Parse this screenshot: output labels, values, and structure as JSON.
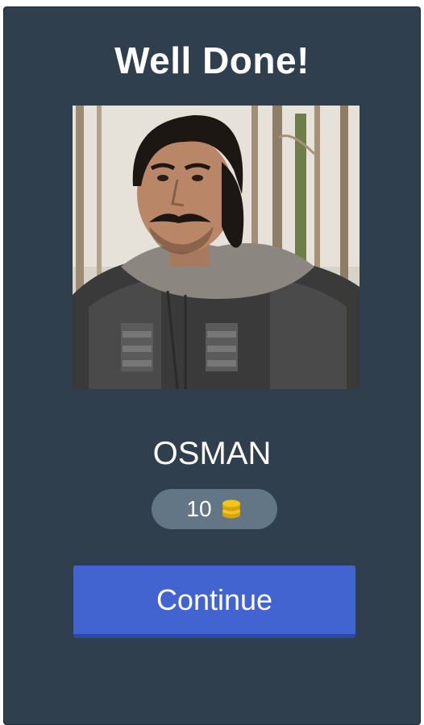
{
  "header": {
    "title": "Well Done!"
  },
  "image": {
    "icon": "character-portrait"
  },
  "answer": {
    "text": "OSMAN"
  },
  "reward": {
    "amount": "10",
    "icon": "coin-stack-icon",
    "coin_color": "#f5c518"
  },
  "actions": {
    "continue_label": "Continue"
  },
  "colors": {
    "panel_background": "#2f3f4e",
    "reward_pill": "#627686",
    "button": "#4264d0"
  }
}
